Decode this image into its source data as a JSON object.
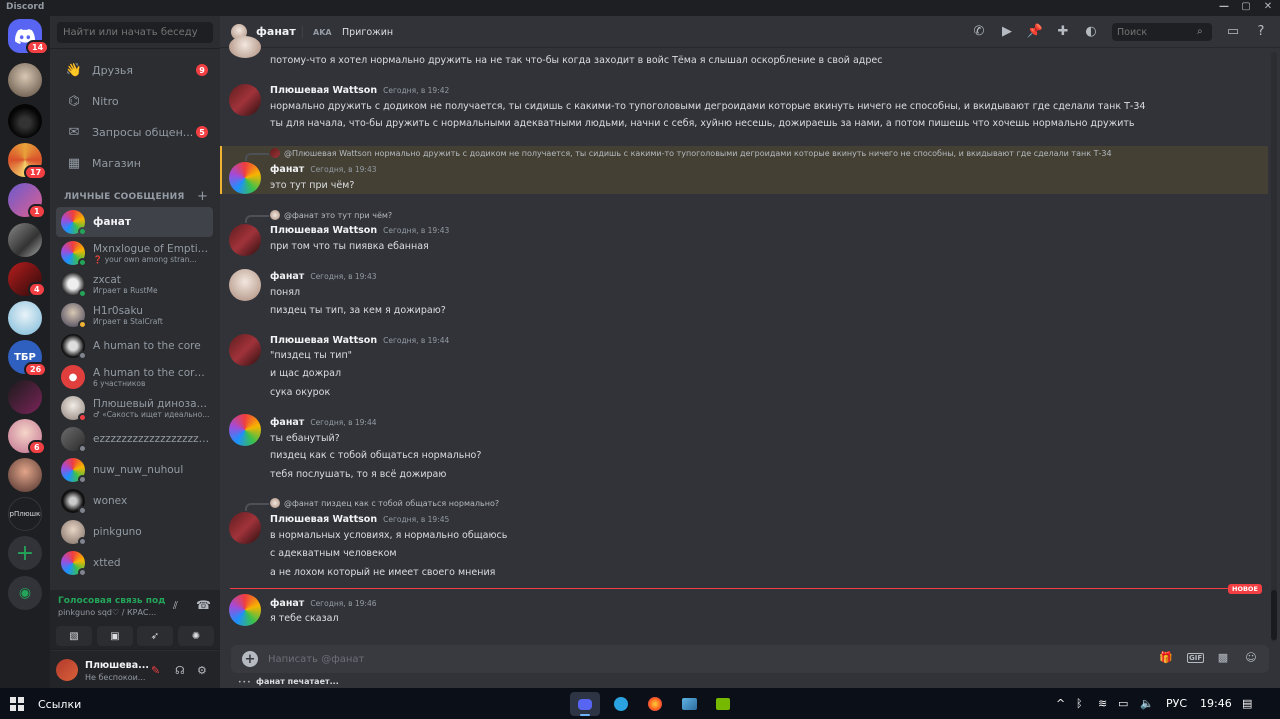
{
  "window": {
    "title": "Discord",
    "controls": [
      "—",
      "▢",
      "✕"
    ]
  },
  "servers": [
    {
      "name": "home",
      "badge": "14"
    },
    {
      "name": "server-1",
      "badge": ""
    },
    {
      "name": "server-2",
      "badge": ""
    },
    {
      "name": "server-3",
      "badge": "17"
    },
    {
      "name": "server-4",
      "badge": "1"
    },
    {
      "name": "server-5",
      "badge": ""
    },
    {
      "name": "server-6",
      "badge": "4"
    },
    {
      "name": "server-7",
      "badge": ""
    },
    {
      "name": "server-8",
      "label": "ТБР",
      "badge": "26"
    },
    {
      "name": "server-9",
      "badge": ""
    },
    {
      "name": "server-10",
      "badge": "6"
    },
    {
      "name": "server-11",
      "badge": ""
    },
    {
      "name": "server-12",
      "label": "epПлюшки",
      "badge": ""
    }
  ],
  "dm_panel": {
    "search_placeholder": "Найти или начать беседу",
    "nav": [
      {
        "label": "Друзья",
        "badge": "9",
        "icon": "friends-icon"
      },
      {
        "label": "Nitro",
        "badge": "",
        "icon": "nitro-icon"
      },
      {
        "label": "Запросы общен...",
        "badge": "5",
        "icon": "mail-icon"
      },
      {
        "label": "Магазин",
        "badge": "",
        "icon": "shop-icon"
      }
    ],
    "section_title": "ЛИЧНЫЕ СООБЩЕНИЯ",
    "conversations": [
      {
        "name": "фанат",
        "sub": "",
        "selected": true
      },
      {
        "name": "Mxnxlogue of Emptin...",
        "sub": "❓ your own among stran..."
      },
      {
        "name": "zxcat",
        "sub": "Играет в RustMe"
      },
      {
        "name": "H1r0saku",
        "sub": "Играет в StalCraft"
      },
      {
        "name": "A human to the core",
        "sub": ""
      },
      {
        "name": "A human to the core, ...",
        "sub": "6 участников"
      },
      {
        "name": "Плюшевый динозав...",
        "sub": "♂ «Сакость ищет идеально..."
      },
      {
        "name": "ezzzzzzzzzzzzzzzzzzz...",
        "sub": ""
      },
      {
        "name": "nuw_nuw_nuhoul",
        "sub": ""
      },
      {
        "name": "wonex",
        "sub": ""
      },
      {
        "name": "pinkguno",
        "sub": ""
      },
      {
        "name": "xtted",
        "sub": ""
      }
    ]
  },
  "voice": {
    "title": "Голосовая связь под",
    "sub": "pinkguno sqd♡ / КРАС..."
  },
  "user": {
    "name": "Плюшева...",
    "status": "Не беспокои..."
  },
  "header": {
    "name": "фанат",
    "aka": "AKA",
    "invite": "Пригожин",
    "search_placeholder": "Поиск"
  },
  "messages": {
    "m0": {
      "line": "потому-что я хотел нормально дружить на не так что-бы когда заходит в войс Тёма я слышал оскорбление в свой адрес"
    },
    "m1": {
      "author": "Плюшевая Wattson",
      "time": "Сегодня, в 19:42",
      "lines": [
        "нормально дружить с додиком не получается, ты сидишь с какими-то тупоголовыми дегроидами которые вкинуть ничего не способны, и вкидывают где сделали танк Т-34",
        "ты для начала, что-бы дружить с нормальными адекватными людьми, начни с себя, хуйню несешь, дожираешь за нами, а потом пишешь что хочешь нормально дружить"
      ]
    },
    "m2": {
      "reply": "@Плюшевая Wattson нормально дружить с додиком не получается, ты сидишь с какими-то тупоголовыми дегроидами которые вкинуть ничего не способны, и вкидывают где сделали танк Т-34",
      "author": "фанат",
      "time": "Сегодня, в 19:43",
      "lines": [
        "это тут при чём?"
      ]
    },
    "m3": {
      "reply": "@фанат это тут при чём?",
      "author": "Плюшевая Wattson",
      "time": "Сегодня, в 19:43",
      "lines": [
        "при том что ты пиявка ебанная"
      ]
    },
    "m4": {
      "author": "фанат",
      "time": "Сегодня, в 19:43",
      "lines": [
        "понял",
        "пиздец ты тип, за кем я дожираю?"
      ]
    },
    "m5": {
      "author": "Плюшевая Wattson",
      "time": "Сегодня, в 19:44",
      "lines": [
        "\"пиздец ты тип\"",
        "и щас дожрал",
        "сука окурок"
      ]
    },
    "m6": {
      "author": "фанат",
      "time": "Сегодня, в 19:44",
      "lines": [
        "ты ебанутый?",
        "пиздец как с тобой общаться нормально?",
        "тебя послушать, то я всё дожираю"
      ]
    },
    "m7": {
      "reply": "@фанат пиздец как с тобой общаться нормально?",
      "author": "Плюшевая Wattson",
      "time": "Сегодня, в 19:45",
      "lines": [
        "в нормальных условиях, я нормально общаюсь",
        "с адекватным человеком",
        "а не лохом который не имеет своего мнения"
      ]
    },
    "m8": {
      "author": "фанат",
      "time": "Сегодня, в 19:46",
      "lines": [
        "я тебе сказал"
      ]
    }
  },
  "new_label": "НОВОЕ",
  "composer": {
    "placeholder": "Написать @фанат",
    "typing": "фанат печатает..."
  },
  "taskbar": {
    "search_label": "Ссылки",
    "lang": "РУС",
    "time": "19:46"
  }
}
